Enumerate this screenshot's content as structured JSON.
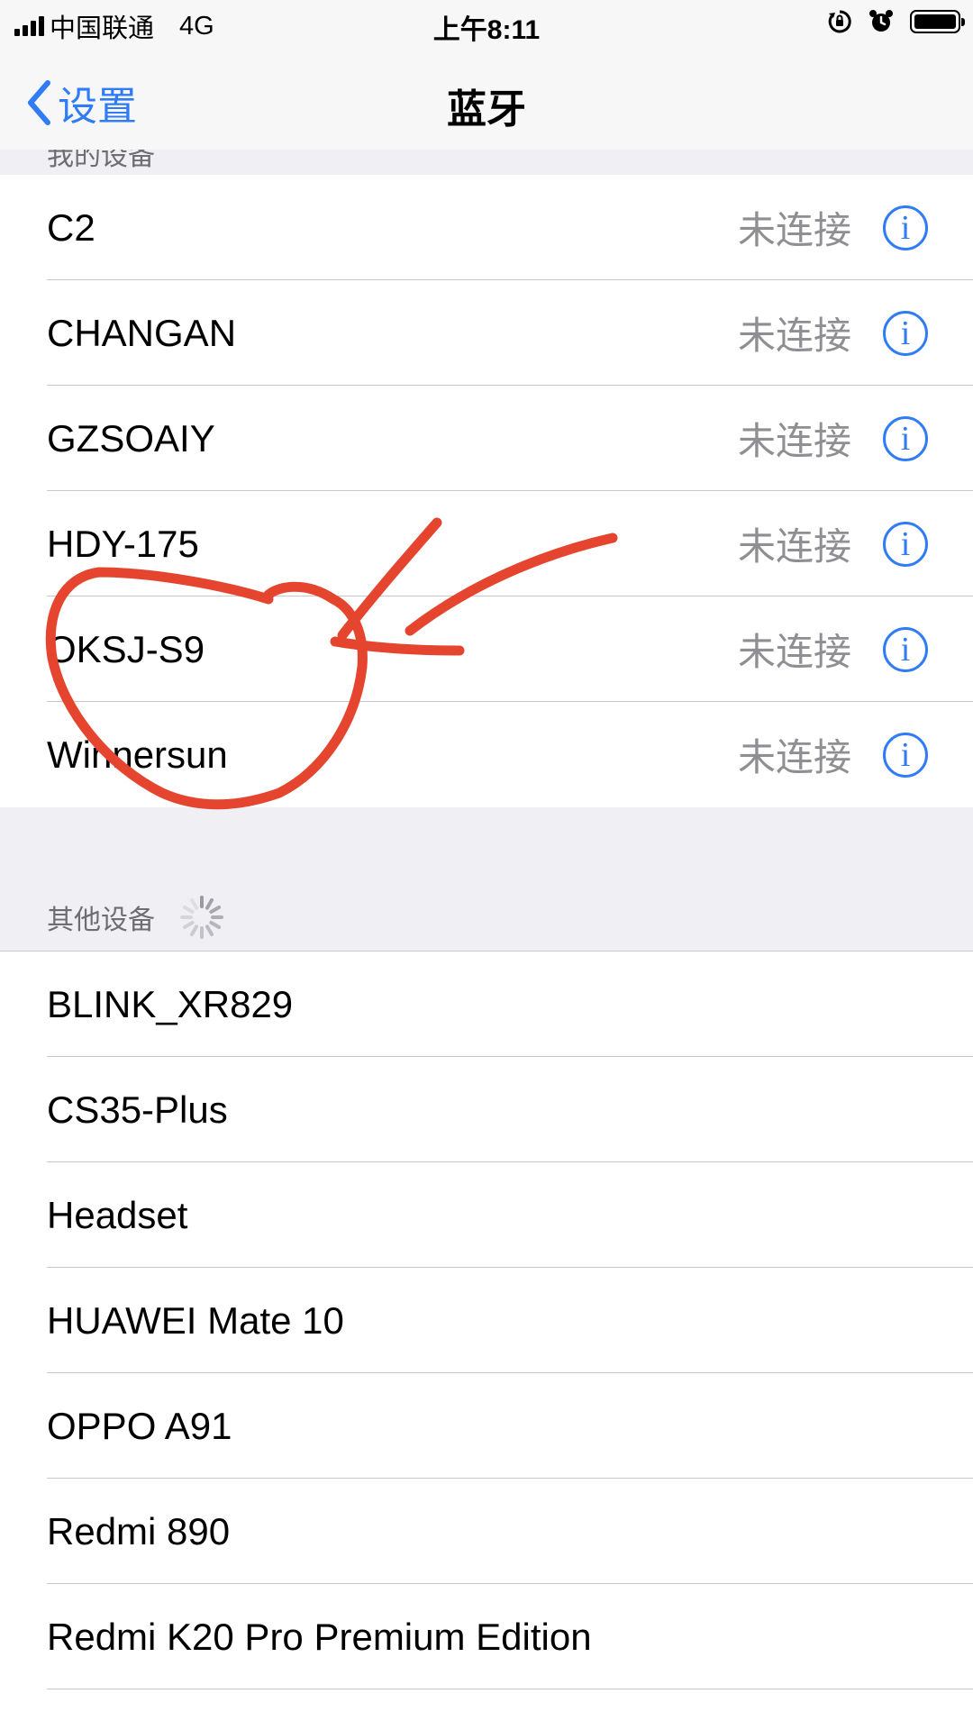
{
  "status_bar": {
    "carrier": "中国联通",
    "network": "4G",
    "time": "上午8:11"
  },
  "nav": {
    "back_label": "设置",
    "title": "蓝牙"
  },
  "my_devices": {
    "header": "我的设备",
    "items": [
      {
        "name": "C2",
        "status": "未连接"
      },
      {
        "name": "CHANGAN",
        "status": "未连接"
      },
      {
        "name": "GZSOAIY",
        "status": "未连接"
      },
      {
        "name": "HDY-175",
        "status": "未连接"
      },
      {
        "name": "OKSJ-S9",
        "status": "未连接"
      },
      {
        "name": "Winnersun",
        "status": "未连接"
      }
    ]
  },
  "other_devices": {
    "header": "其他设备",
    "items": [
      {
        "name": "BLINK_XR829"
      },
      {
        "name": "CS35-Plus"
      },
      {
        "name": "Headset"
      },
      {
        "name": "HUAWEI Mate 10"
      },
      {
        "name": "OPPO A91"
      },
      {
        "name": "Redmi 890"
      },
      {
        "name": "Redmi K20 Pro Premium Edition"
      }
    ]
  },
  "colors": {
    "accent": "#2f7cf6",
    "annotation": "#e5452f",
    "background": "#efeff4"
  }
}
